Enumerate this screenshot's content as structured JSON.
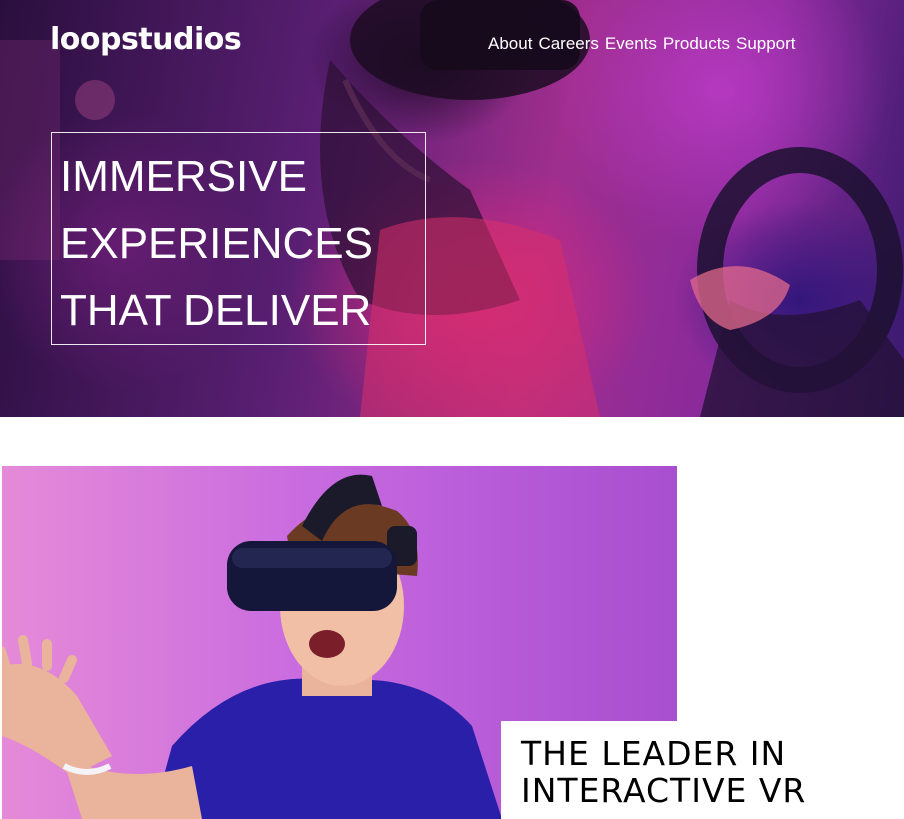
{
  "brand": {
    "logo_text": "loopstudios"
  },
  "nav": {
    "items": [
      {
        "label": "About"
      },
      {
        "label": "Careers"
      },
      {
        "label": "Events"
      },
      {
        "label": "Products"
      },
      {
        "label": "Support"
      }
    ]
  },
  "hero": {
    "headline_lines": [
      "IMMERSIVE",
      "EXPERIENCES",
      "THAT DELIVER"
    ]
  },
  "interactive": {
    "heading_lines": [
      "THE LEADER IN",
      "INTERACTIVE VR"
    ]
  },
  "colors": {
    "hero_accent": "#a02e8e",
    "photo_background": "#c96be0",
    "text_light": "#ffffff",
    "text_dark": "#000000"
  }
}
